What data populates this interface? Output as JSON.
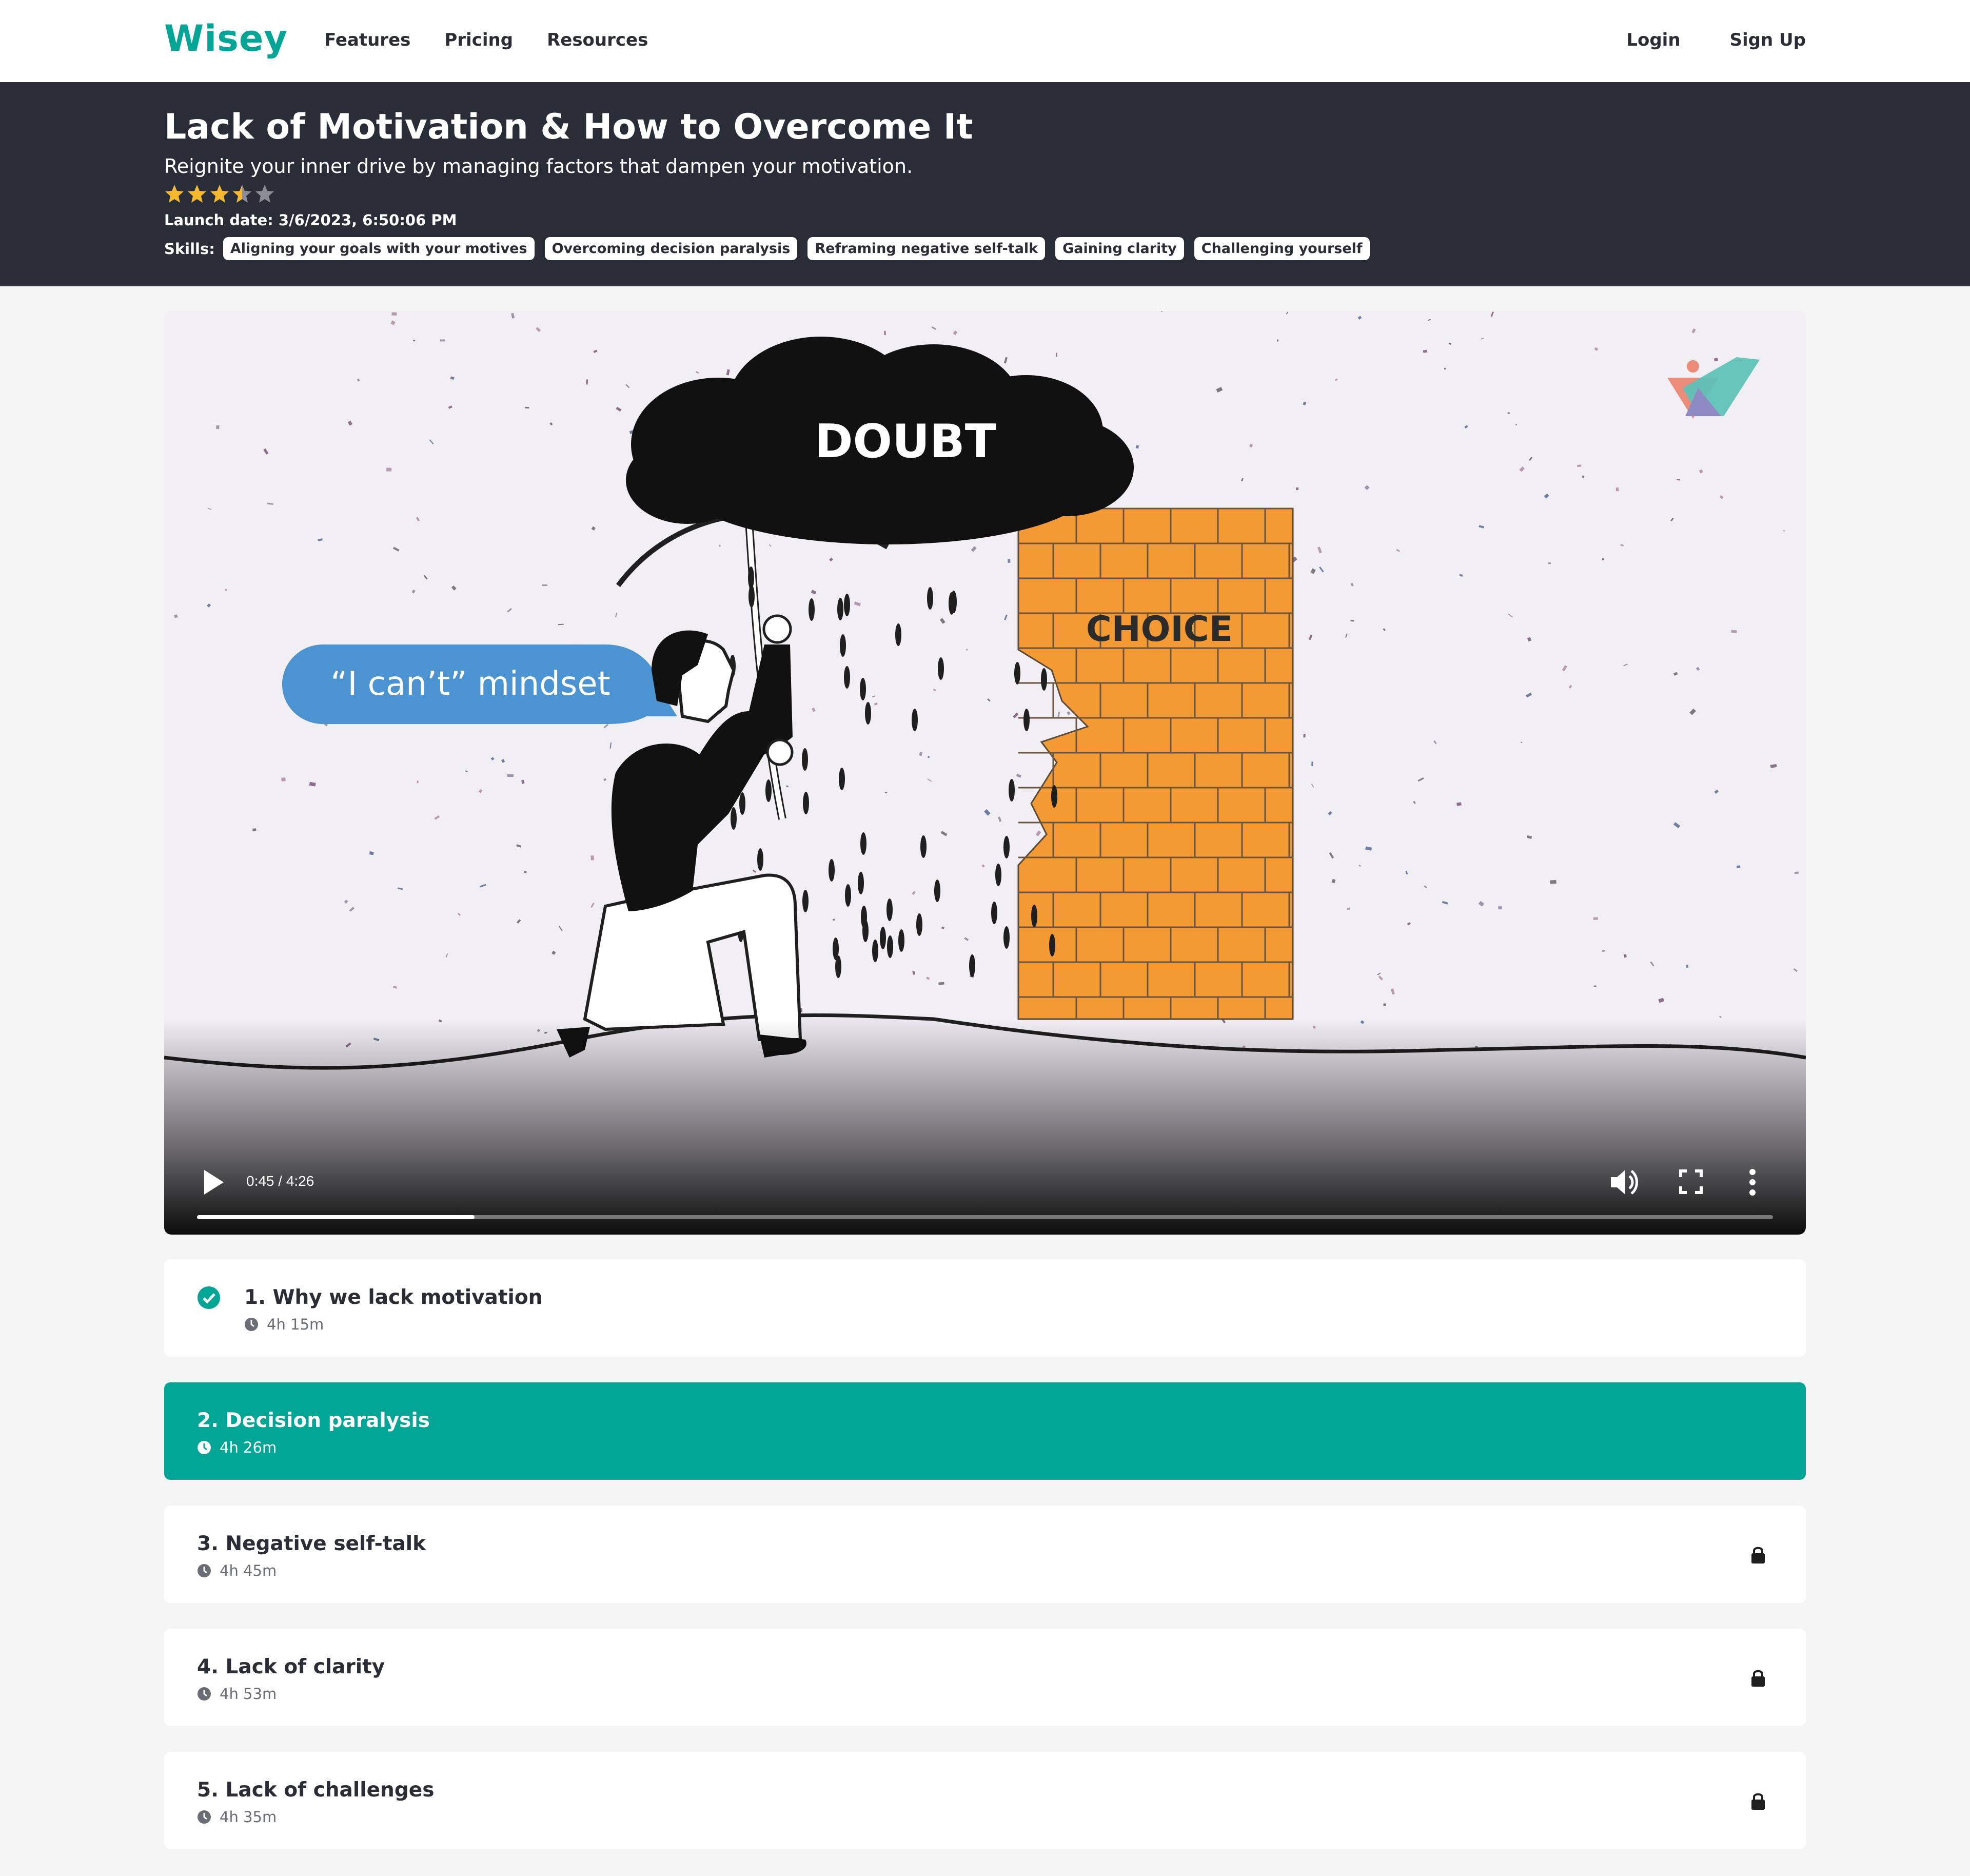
{
  "nav": {
    "logo": "Wisey",
    "links": [
      "Features",
      "Pricing",
      "Resources"
    ],
    "login": "Login",
    "signup": "Sign Up"
  },
  "course": {
    "title": "Lack of Motivation & How to Overcome It",
    "subtitle": "Reignite your inner drive by managing factors that dampen your motivation.",
    "rating": 3.5,
    "rating_max": 5,
    "launch": "Launch date: 3/6/2023, 6:50:06 PM",
    "skills_label": "Skills:",
    "skills": [
      "Aligning your goals with your motives",
      "Overcoming decision paralysis",
      "Reframing negative self-talk",
      "Gaining clarity",
      "Challenging yourself"
    ]
  },
  "video": {
    "cloud_text": "DOUBT",
    "wall_text": "CHOICE",
    "bubble_text": "“I can’t” mindset",
    "time": "0:45 / 4:26",
    "progress": 0.176,
    "controls": [
      "play-icon",
      "volume-icon",
      "fullscreen-icon",
      "more-icon"
    ]
  },
  "lessons": [
    {
      "title": "1. Why we lack motivation",
      "duration": "4h 15m",
      "state": "completed"
    },
    {
      "title": "2. Decision paralysis",
      "duration": "4h 26m",
      "state": "active"
    },
    {
      "title": "3. Negative self-talk",
      "duration": "4h 45m",
      "state": "locked"
    },
    {
      "title": "4. Lack of clarity",
      "duration": "4h 53m",
      "state": "locked"
    },
    {
      "title": "5. Lack of challenges",
      "duration": "4h 35m",
      "state": "locked"
    }
  ],
  "colors": {
    "brand": "#00a596",
    "hero_bg": "#292d37",
    "star": "#f5b82e",
    "star_empty": "#8a8d94",
    "bubble": "#4c93d1",
    "wall": "#f39a35"
  }
}
